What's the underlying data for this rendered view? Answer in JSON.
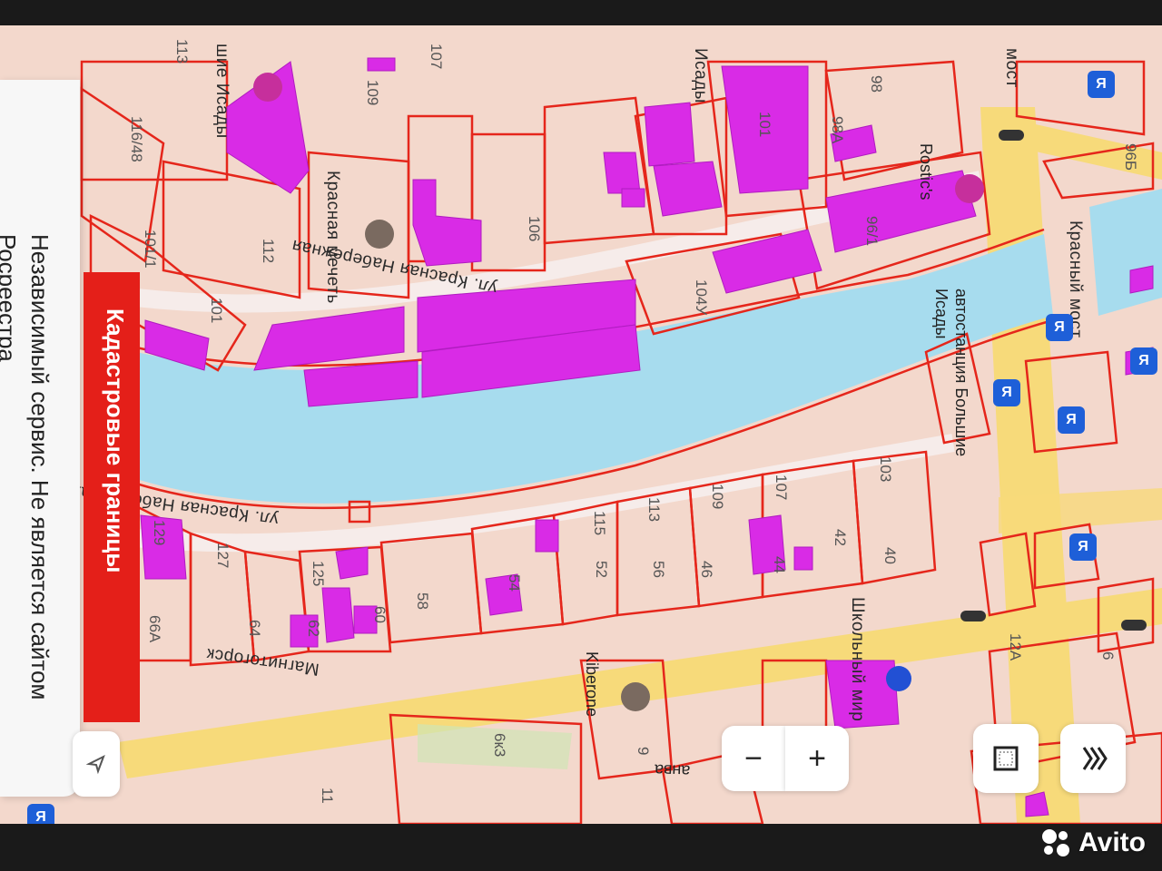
{
  "map": {
    "streets": {
      "krasnaya_naberezhnaya_top": "ул. Красная Набережная",
      "krasnaya_naberezhnaya_bottom": "ул. Красная Набережная",
      "magnitogorskaya": "Магнитогорск",
      "krasny_most": "Красный мост",
      "most": "мост",
      "bolshie_isady_top": "шие Исады",
      "bolshie_isady_mid": "Исады",
      "shkolny_mir": "Школьный мир"
    },
    "pois": {
      "krasnaya_mechet": "Красная мечеть",
      "rostics": "Rostic's",
      "avtostantsiya": "автостанция Большие Исады",
      "kiberone": "Kiberone",
      "clipped_label": "анва"
    },
    "house_numbers": {
      "n113_top": "113",
      "n107_top": "107",
      "n109_top": "109",
      "n98": "98",
      "n98a": "98А",
      "n101": "101",
      "n116_48": "116/48",
      "n101_1": "101/1",
      "n112": "112",
      "n101_left": "101",
      "n106": "106",
      "n104u": "104У",
      "n96_1": "96/1",
      "n96b": "96Б",
      "n129": "129",
      "n127": "127",
      "n125": "125",
      "n66a": "66А",
      "n64": "64",
      "n62": "62",
      "n60": "60",
      "n58": "58",
      "n54": "54",
      "n115": "115",
      "n52": "52",
      "n113_bot": "113",
      "n56": "56",
      "n109_bot": "109",
      "n46": "46",
      "n107_bot": "107",
      "n44": "44",
      "n42": "42",
      "n103": "103",
      "n40": "40",
      "n6k3": "6к3",
      "n11": "11",
      "n6": "6",
      "n12a": "12А",
      "n9": "9"
    },
    "transport_badges": [
      "Я",
      "Я",
      "Я",
      "Я",
      "Я",
      "Я",
      "Я"
    ]
  },
  "side_panel": {
    "text": "Независимый сервис. Не является сайтом Росреестра"
  },
  "banner": {
    "text": "Кадастровые границы"
  },
  "controls": {
    "zoom_out": "−",
    "zoom_in": "+",
    "layers_icon": "layers-icon",
    "frame_icon": "frame-icon",
    "locate_icon": "locate-arrow-icon"
  },
  "watermark": {
    "text": "Avito"
  },
  "colors": {
    "land": "#f3d8cc",
    "water": "#a7dcee",
    "road_yellow": "#f7da7a",
    "boundary_red": "#e5261b",
    "building_magenta": "#d92be6",
    "banner_red": "#e41f19",
    "badge_blue": "#1e5fd8"
  }
}
